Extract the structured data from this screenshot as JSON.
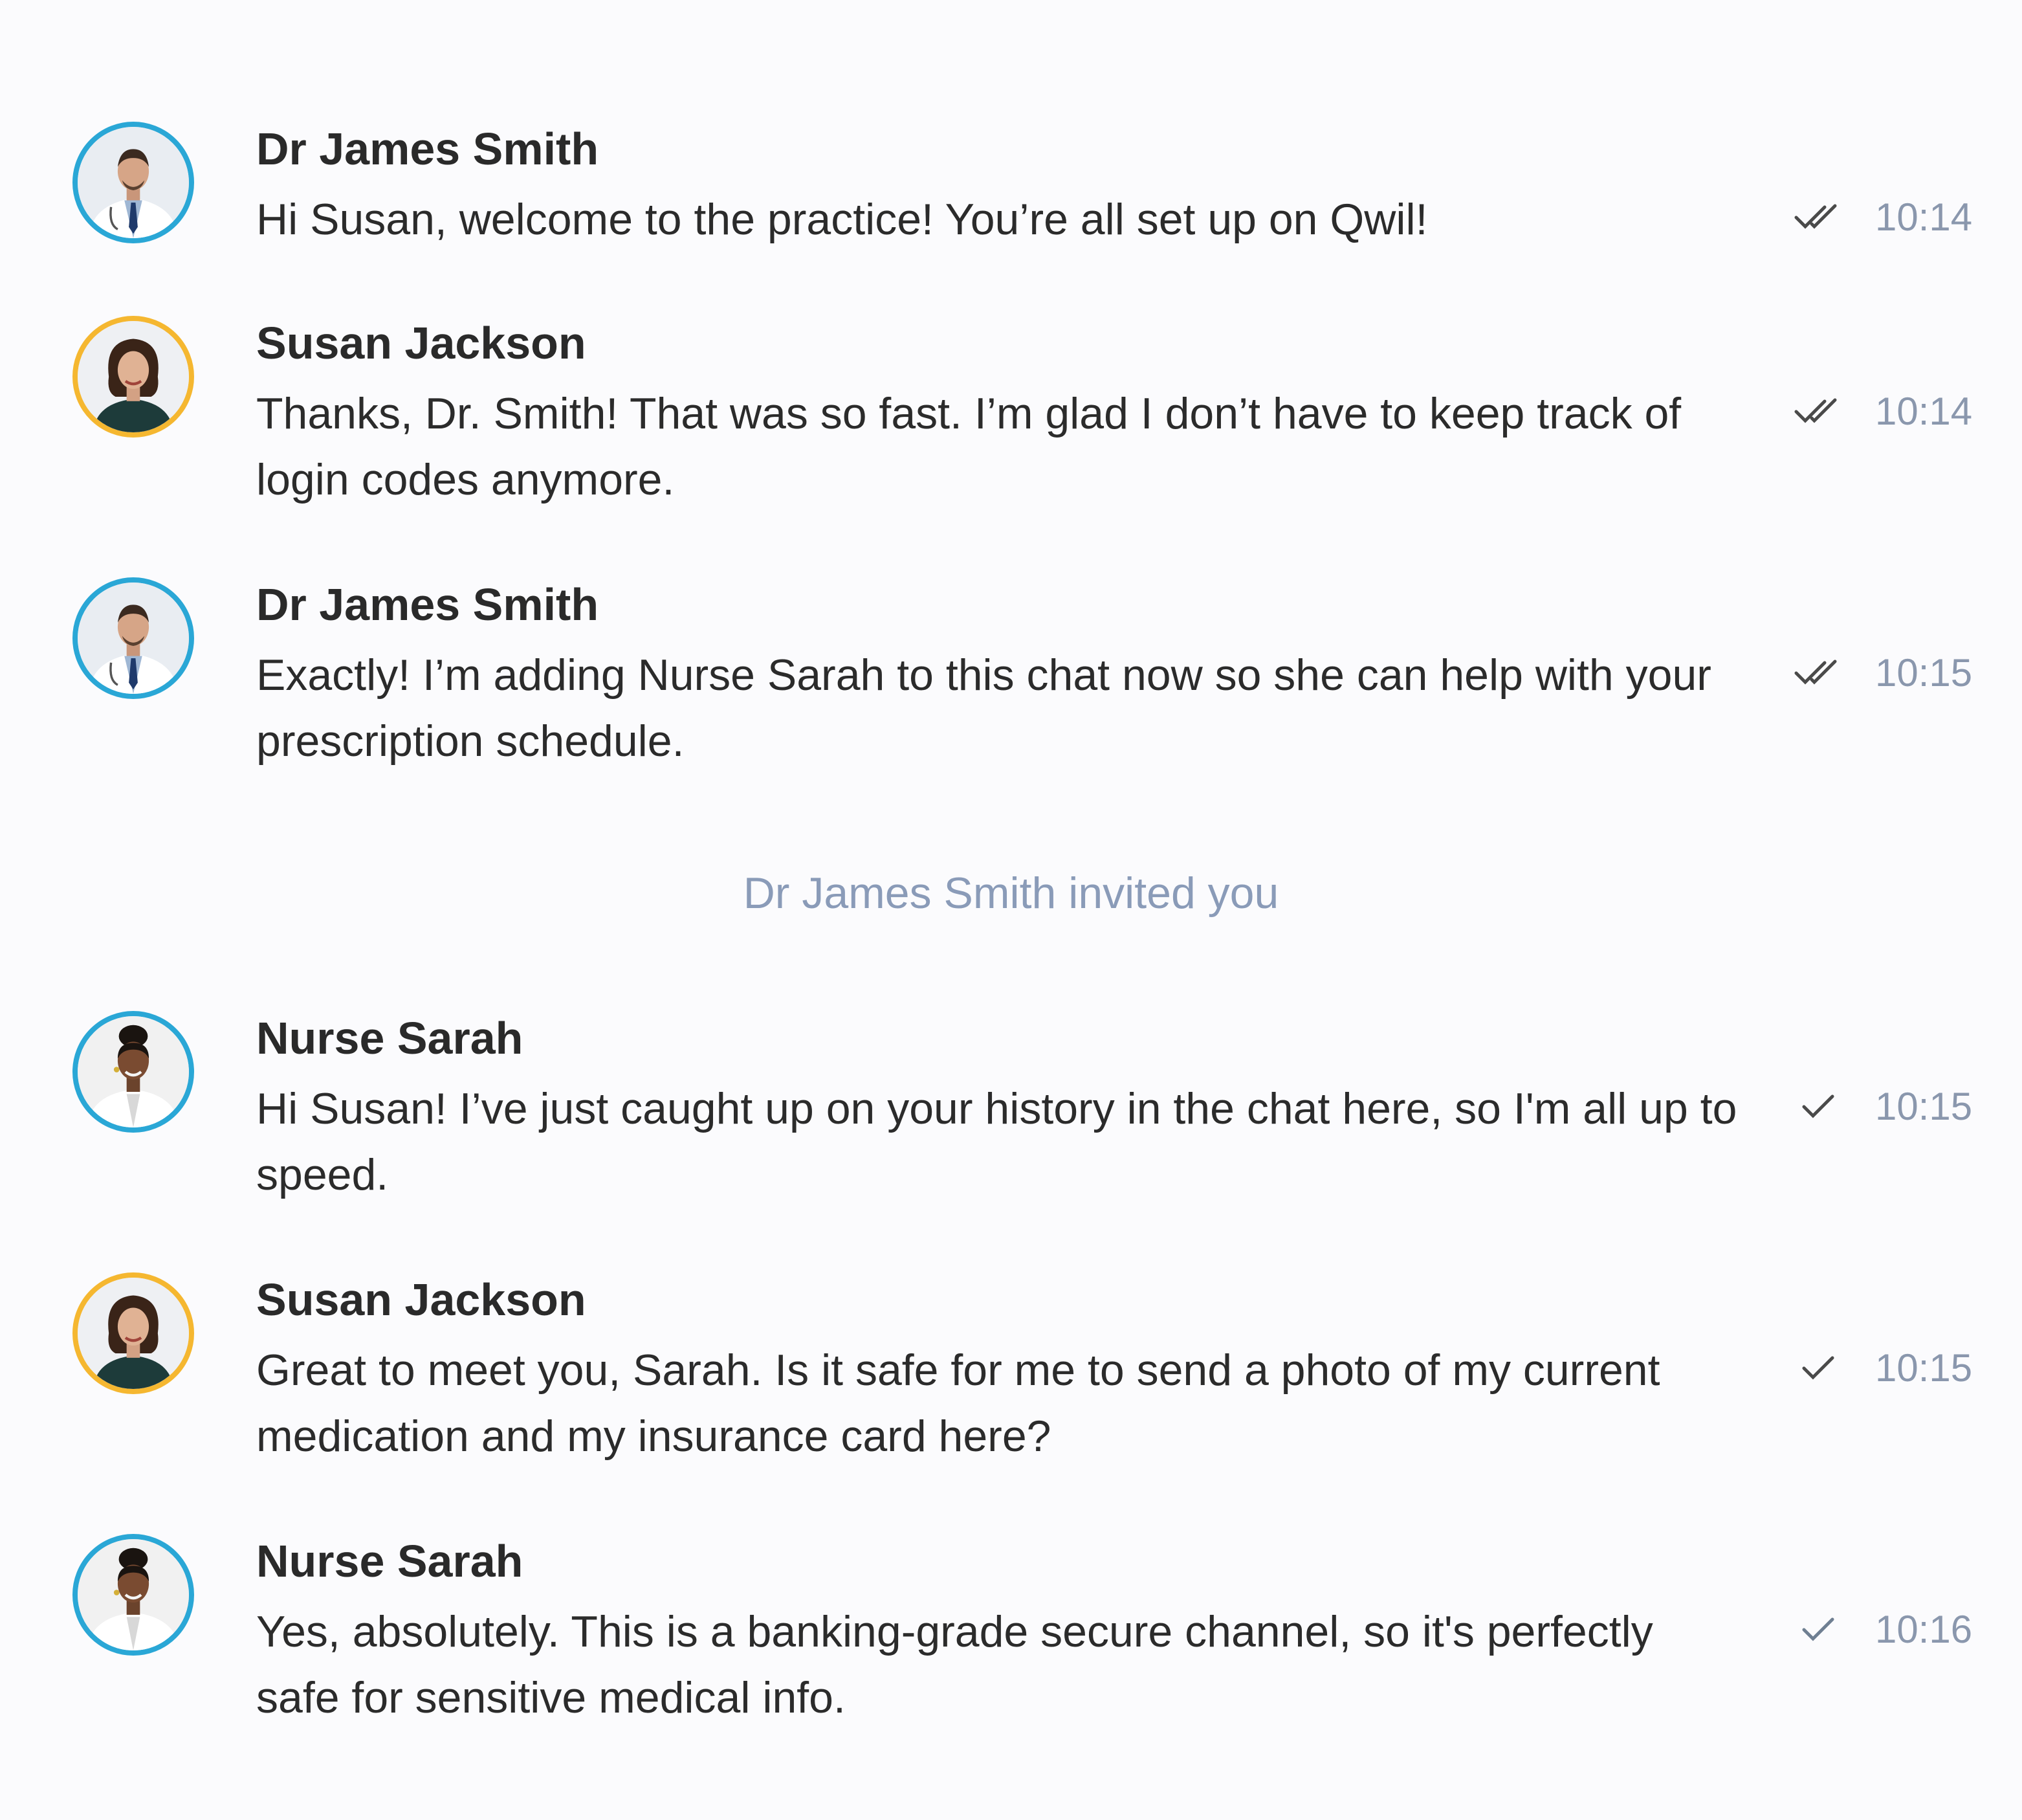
{
  "colors": {
    "doctor_ring": "#2aa7d6",
    "patient_ring": "#f5b730",
    "nurse_ring": "#2aa7d6",
    "meta_text": "#8a97ad",
    "system_text": "#8a9bb8"
  },
  "messages": [
    {
      "sender": "Dr James Smith",
      "avatar_icon": "doctor-avatar-icon",
      "text": "Hi Susan, welcome to the practice! You’re all set up on Qwil!",
      "status_icon": "double-check-icon",
      "time": "10:14"
    },
    {
      "sender": "Susan Jackson",
      "avatar_icon": "patient-avatar-icon",
      "text": "Thanks, Dr. Smith! That was so fast. I’m glad I don’t have to keep track of login codes anymore.",
      "status_icon": "double-check-icon",
      "time": "10:14"
    },
    {
      "sender": "Dr James Smith",
      "avatar_icon": "doctor-avatar-icon",
      "text": "Exactly! I’m adding Nurse Sarah to this chat now so she can help with your prescription schedule.",
      "status_icon": "double-check-icon",
      "time": "10:15"
    },
    {
      "sender": "Nurse Sarah",
      "avatar_icon": "nurse-avatar-icon",
      "text": "Hi Susan! I’ve just caught up on your history in the chat here, so I'm all up to speed.",
      "status_icon": "single-check-icon",
      "time": "10:15"
    },
    {
      "sender": "Susan Jackson",
      "avatar_icon": "patient-avatar-icon",
      "text": "Great to meet you, Sarah. Is it safe for me to send a photo of my current medication and my insurance card here?",
      "status_icon": "single-check-icon",
      "time": "10:15"
    },
    {
      "sender": "Nurse Sarah",
      "avatar_icon": "nurse-avatar-icon",
      "text": "Yes, absolutely. This is a banking-grade secure channel, so it's perfectly safe for sensitive medical info.",
      "status_icon": "single-check-icon",
      "time": "10:16"
    }
  ],
  "system_notice": "Dr James Smith invited you"
}
